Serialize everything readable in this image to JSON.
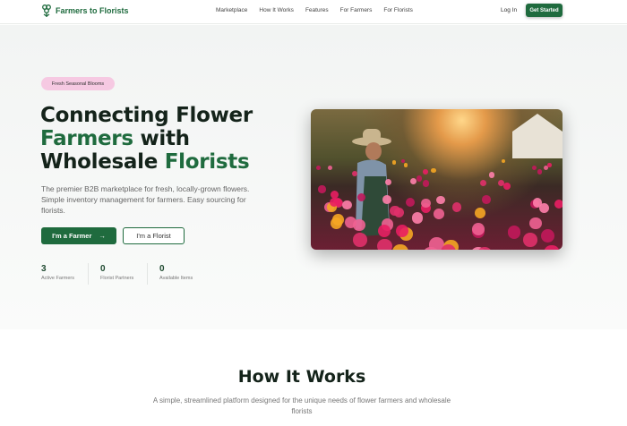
{
  "nav": {
    "brand": "Farmers to Florists",
    "links": [
      "Marketplace",
      "How It Works",
      "Features",
      "For Farmers",
      "For Florists"
    ],
    "login": "Log In",
    "cta": "Get Started"
  },
  "hero": {
    "badge": "Fresh Seasonal Blooms",
    "title_1": "Connecting Flower",
    "title_2a": "Farmers",
    "title_2b": " with",
    "title_3a": "Wholesale ",
    "title_3b": "Florists",
    "description": "The premier B2B marketplace for fresh, locally-grown flowers. Simple inventory management for farmers. Easy sourcing for florists.",
    "farmer_button": "I'm a Farmer",
    "farmer_arrow": "→",
    "florist_button": "I'm a Florist",
    "stats": [
      {
        "value": "3",
        "label": "Active Farmers"
      },
      {
        "value": "0",
        "label": "Florist Partners"
      },
      {
        "value": "0",
        "label": "Available Items"
      }
    ]
  },
  "how": {
    "title": "How It Works",
    "subtitle": "A simple, streamlined platform designed for the unique needs of flower farmers and wholesale florists"
  },
  "colors": {
    "brand": "#1f6b3e",
    "badge": "#f6c9e2"
  }
}
